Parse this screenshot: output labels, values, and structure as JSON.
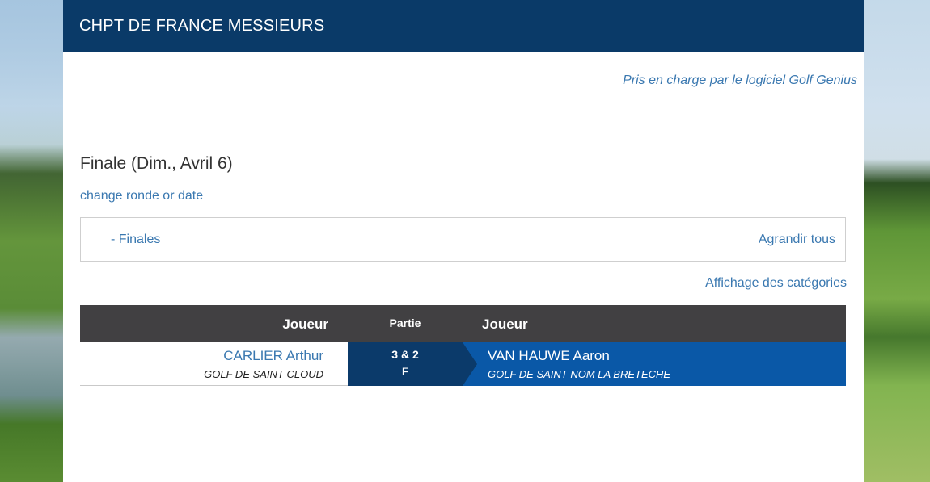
{
  "header": {
    "title": "CHPT DE FRANCE MESSIEURS"
  },
  "powered_by": "Pris en charge par le logiciel Golf Genius",
  "round": {
    "title": "Finale (Dim., Avril 6)",
    "change_link": "change ronde or date"
  },
  "finals_panel": {
    "label": "- Finales",
    "expand_all": "Agrandir tous"
  },
  "categories_link": "Affichage des catégories",
  "table": {
    "headers": {
      "player_left": "Joueur",
      "match": "Partie",
      "player_right": "Joueur"
    },
    "rows": [
      {
        "player1": {
          "name": "CARLIER Arthur",
          "club": "GOLF DE SAINT CLOUD"
        },
        "score": "3 & 2",
        "status": "F",
        "player2": {
          "name": "VAN HAUWE Aaron",
          "club": "GOLF DE SAINT NOM LA BRETECHE"
        }
      }
    ]
  },
  "colors": {
    "header_bg": "#0a3a68",
    "link": "#3a78b0",
    "table_header_bg": "#414042",
    "match_cell_bg": "#0b3a6a",
    "winner_bg": "#0a58a7"
  }
}
